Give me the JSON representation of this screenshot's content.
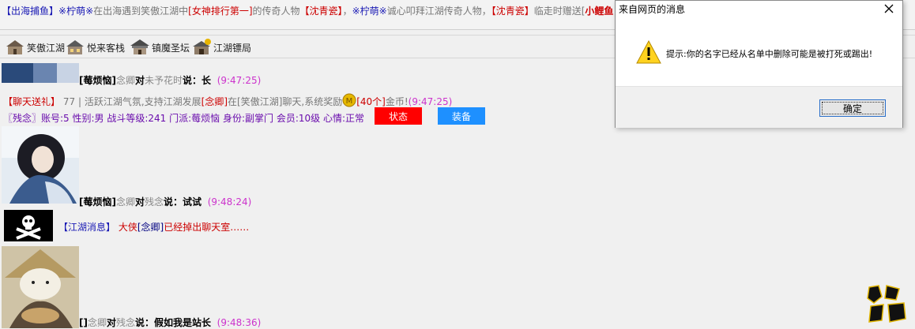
{
  "marquee": {
    "tag": "【出海捕鱼】",
    "user1": "※柠萌※",
    "text1": "在出海遇到笑傲江湖中",
    "rank": "[女神排行第一]",
    "text2": "的传奇人物",
    "npc": "【沈青瓷】",
    "text3": "，",
    "user2": "※柠萌※",
    "text4": "诚心叩拜江湖传奇人物，",
    "npc2": "【沈青瓷】",
    "text5": "临走时赠送[",
    "gift": "小鲤鱼"
  },
  "nav": {
    "items": [
      {
        "label": "笑傲江湖"
      },
      {
        "label": "悦来客栈"
      },
      {
        "label": "镇魔圣坛"
      },
      {
        "label": "江湖镖局"
      }
    ]
  },
  "chat": {
    "msg1": {
      "speaker": "[莓烦恼]",
      "from": "念卿",
      "dui": "对",
      "to": "未予花时",
      "say": "说：长",
      "time": "(9:47:25)"
    },
    "reward": {
      "tag": "【聊天送礼】",
      "count": "77",
      "sep": "|",
      "text1": "活跃江湖气氛,支持江湖发展",
      "user": "[念卿]",
      "text2": "在[笑傲江湖]聊天,系统奖励",
      "coin": "[40个]",
      "text3": "金币!",
      "time": "(9:47:25)"
    },
    "profile": {
      "text": "〖残念〗账号:5 性别:男  战斗等级:241 门派:莓烦恼 身份:副掌门 会员:10级 心情:正常",
      "status_btn": "状态",
      "equip_btn": "装备"
    },
    "msg2": {
      "speaker": "[莓烦恼]",
      "from": "念卿",
      "dui": "对",
      "to": "残念",
      "say": "说：试试",
      "time": "(9:48:24)"
    },
    "system": {
      "tag": "【江湖消息】",
      "title": "大侠",
      "user": "[念卿]",
      "text": "已经掉出聊天室……"
    },
    "msg3": {
      "speaker": "[]",
      "from": "念卿",
      "dui": "对",
      "to": "残念",
      "say": "说：假如我是站长",
      "time": "(9:48:36)"
    }
  },
  "dialog": {
    "title": "来自网页的消息",
    "message": "提示:你的名字已经从名单中删除可能是被打死或踢出!",
    "ok_label": "确定"
  },
  "colors": {
    "status_btn": "#ff0000",
    "equip_btn": "#1e90ff"
  }
}
